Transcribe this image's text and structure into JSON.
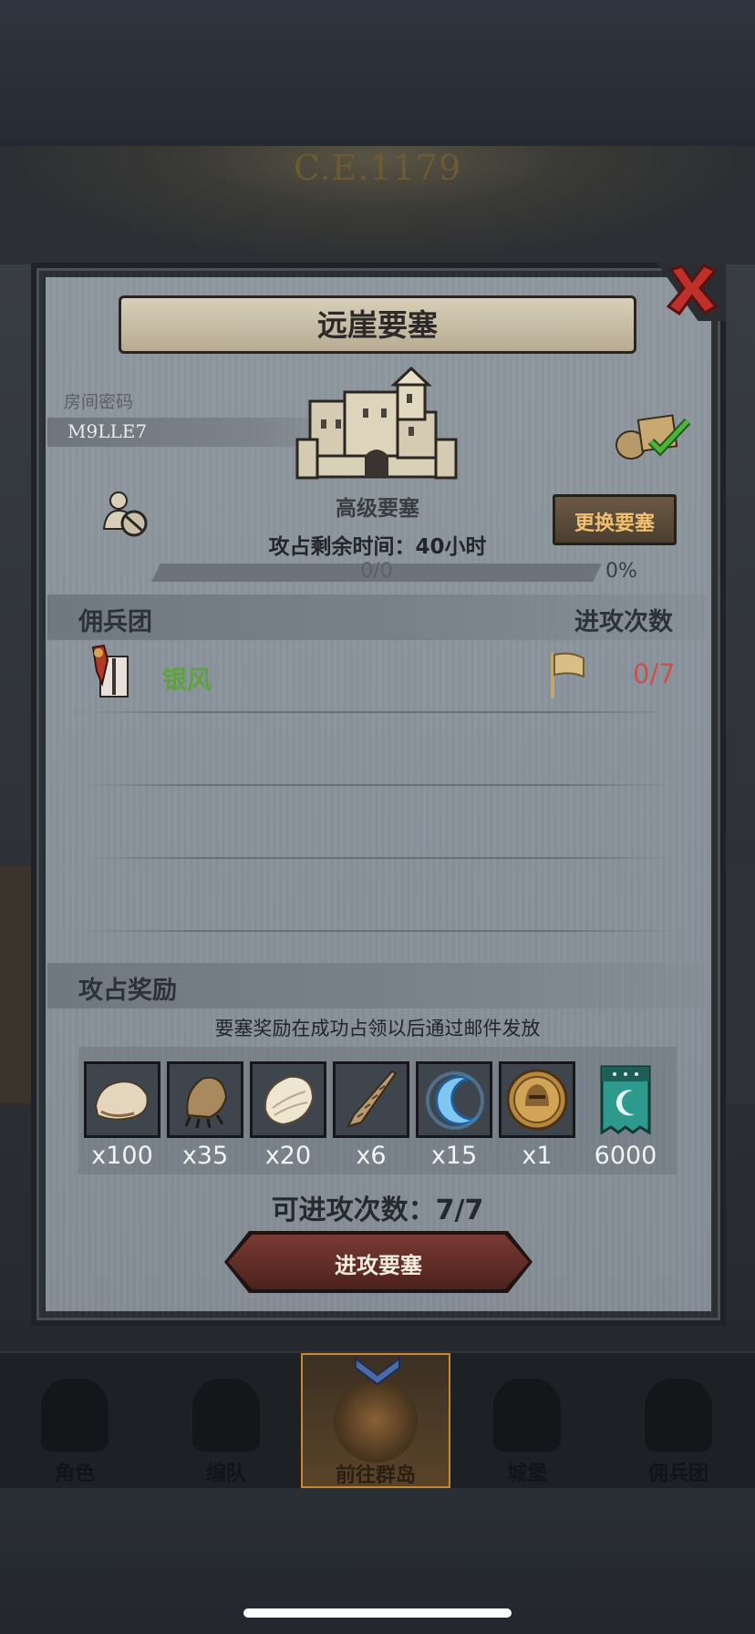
{
  "background": {
    "year": "C.E.1179"
  },
  "dialog": {
    "title": "远崖要塞",
    "room_label": "房间密码",
    "room_code": "M9LLE7",
    "fort_type": "高级要塞",
    "change_button": "更换要塞",
    "time_remaining": "攻占剩余时间：40小时",
    "progress_text": "0/0",
    "progress_percent": "0%",
    "progress_fraction": 0,
    "mercenary_header": "佣兵团",
    "attack_header": "进攻次数",
    "guild": {
      "name": "银风",
      "attack_count": "0/7",
      "emblem_icon": "guild-emblem-icon",
      "flag_icon": "flag-icon"
    },
    "rewards_header": "攻占奖励",
    "rewards_note": "要塞奖励在成功占领以后通过邮件发放",
    "rewards": [
      {
        "icon": "fur-pelt-icon",
        "qty": "x100"
      },
      {
        "icon": "beast-claw-icon",
        "qty": "x35"
      },
      {
        "icon": "hide-icon",
        "qty": "x20"
      },
      {
        "icon": "horn-icon",
        "qty": "x6"
      },
      {
        "icon": "blue-crescent-icon",
        "qty": "x15"
      },
      {
        "icon": "knight-medal-icon",
        "qty": "x1"
      },
      {
        "icon": "fortress-banner-icon",
        "qty": "6000"
      }
    ],
    "attempts": "可进攻次数：7/7",
    "attack_button": "进攻要塞"
  },
  "nav": {
    "items": [
      {
        "label": "角色"
      },
      {
        "label": "编队"
      },
      {
        "label": "前往群岛",
        "active": true
      },
      {
        "label": "城堡"
      },
      {
        "label": "佣兵团"
      }
    ]
  },
  "colors": {
    "accent_gold": "#d7a64a",
    "guild_green": "#5fa23e",
    "count_red": "#c9524e"
  }
}
